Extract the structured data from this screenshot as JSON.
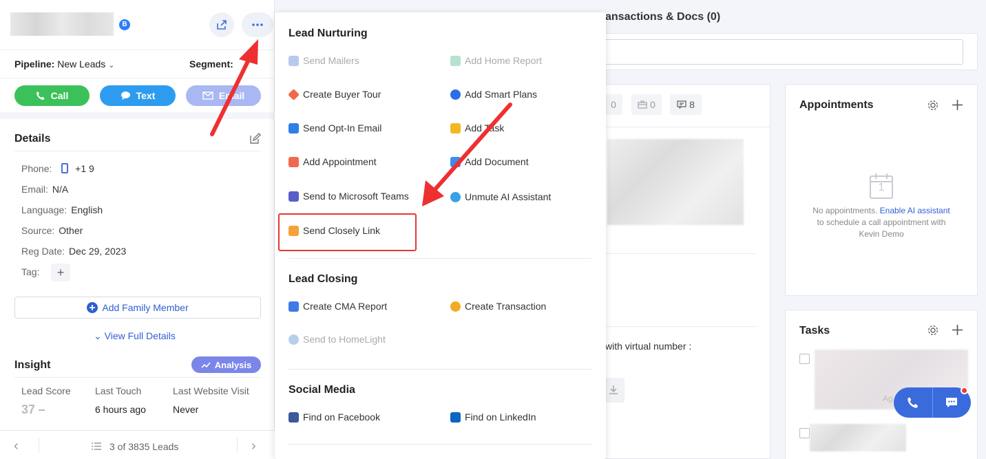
{
  "lead": {
    "badge": "B",
    "pipeline_label": "Pipeline:",
    "pipeline_value": "New Leads",
    "segment_label": "Segment:"
  },
  "actions": {
    "call": "Call",
    "text": "Text",
    "email": "Email"
  },
  "details": {
    "title": "Details",
    "phone_label": "Phone:",
    "phone_value": "+1 9",
    "email_label": "Email:",
    "email_value": "N/A",
    "language_label": "Language:",
    "language_value": "English",
    "source_label": "Source:",
    "source_value": "Other",
    "reg_date_label": "Reg Date:",
    "reg_date_value": "Dec 29, 2023",
    "tag_label": "Tag:",
    "add_family": "Add Family Member",
    "view_full": "View Full Details"
  },
  "insight": {
    "title": "Insight",
    "analysis": "Analysis",
    "cols": [
      "Lead Score",
      "Last Touch",
      "Last Website Visit"
    ],
    "score": "37",
    "last_touch": "6 hours ago",
    "last_visit": "Never"
  },
  "pager": {
    "label": "3 of 3835 Leads"
  },
  "menu": {
    "sections": {
      "nurturing": "Lead Nurturing",
      "closing": "Lead Closing",
      "social": "Social Media"
    },
    "items": {
      "send_mailers": "Send Mailers",
      "add_home_report": "Add Home Report",
      "create_buyer_tour": "Create Buyer Tour",
      "add_smart_plans": "Add Smart Plans",
      "send_opt_in": "Send Opt-In Email",
      "add_task": "Add Task",
      "add_appointment": "Add Appointment",
      "add_document": "Add Document",
      "send_teams": "Send to Microsoft Teams",
      "unmute_ai": "Unmute AI Assistant",
      "send_closely": "Send Closely Link",
      "create_cma": "Create CMA Report",
      "create_transaction": "Create Transaction",
      "send_homelight": "Send to HomeLight",
      "find_facebook": "Find on Facebook",
      "find_linkedin": "Find on LinkedIn"
    }
  },
  "content": {
    "transactions_title": "ansactions & Docs (0)",
    "chip_1": "0",
    "chip_2": "0",
    "chip_3": "8",
    "virtual_number": "with virtual number :"
  },
  "appointments": {
    "title": "Appointments",
    "empty_prefix": "No appointments.",
    "empty_link": "Enable AI assistant",
    "empty_suffix": "to schedule a call appointment with Kevin Demo",
    "calendar_day": "1"
  },
  "tasks": {
    "title": "Tasks",
    "blur_label": "Ag"
  },
  "colors": {
    "call": "#3cc15a",
    "text": "#2d9cf0",
    "email": "#a9b8f2",
    "accent": "#2f5fd3",
    "highlight": "#e53935"
  }
}
